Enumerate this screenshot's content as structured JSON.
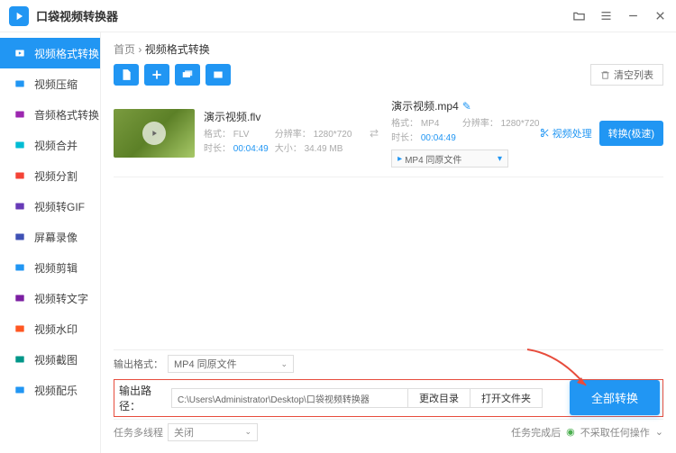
{
  "app": {
    "title": "口袋视频转换器"
  },
  "win": {
    "folder": "folder",
    "menu": "menu",
    "min": "min",
    "close": "close"
  },
  "sidebar": {
    "items": [
      {
        "label": "视频格式转换",
        "icon": "convert",
        "color": "#fff"
      },
      {
        "label": "视频压缩",
        "icon": "compress",
        "color": "#2196f3"
      },
      {
        "label": "音频格式转换",
        "icon": "audio",
        "color": "#9c27b0"
      },
      {
        "label": "视频合并",
        "icon": "merge",
        "color": "#00bcd4"
      },
      {
        "label": "视频分割",
        "icon": "split",
        "color": "#f44336"
      },
      {
        "label": "视频转GIF",
        "icon": "gif",
        "color": "#673ab7"
      },
      {
        "label": "屏幕录像",
        "icon": "record",
        "color": "#3f51b5"
      },
      {
        "label": "视频剪辑",
        "icon": "cut",
        "color": "#2196f3"
      },
      {
        "label": "视频转文字",
        "icon": "text",
        "color": "#7b1fa2"
      },
      {
        "label": "视频水印",
        "icon": "watermark",
        "color": "#ff5722"
      },
      {
        "label": "视频截图",
        "icon": "screenshot",
        "color": "#009688"
      },
      {
        "label": "视频配乐",
        "icon": "music",
        "color": "#2196f3"
      }
    ]
  },
  "crumbs": {
    "home": "首页",
    "current": "视频格式转换"
  },
  "toolbar": {
    "clear": "清空列表"
  },
  "item": {
    "src_name": "演示视频.flv",
    "fmt_label": "格式：",
    "fmt_val": "FLV",
    "res_label": "分辨率：",
    "res_val": "1280*720",
    "dur_label": "时长：",
    "dur_val": "00:04:49",
    "size_label": "大小：",
    "size_val": "34.49 MB",
    "out_name": "演示视频.mp4",
    "out_fmt_label": "格式：",
    "out_fmt_val": "MP4",
    "out_res_label": "分辨率：",
    "out_res_val": "1280*720",
    "out_dur_label": "时长：",
    "out_dur_val": "00:04:49",
    "out_select": "MP4 同原文件",
    "process": "视频处理",
    "convert": "转换(极速)"
  },
  "bottom": {
    "fmt_label": "输出格式：",
    "fmt_val": "MP4 同原文件",
    "path_label": "输出路径：",
    "path_val": "C:\\Users\\Administrator\\Desktop\\口袋视频转换器",
    "change_dir": "更改目录",
    "open_folder": "打开文件夹",
    "convert_all": "全部转换",
    "thread_label": "任务多线程",
    "thread_val": "关闭",
    "done_label": "任务完成后",
    "done_val": "不采取任何操作"
  }
}
